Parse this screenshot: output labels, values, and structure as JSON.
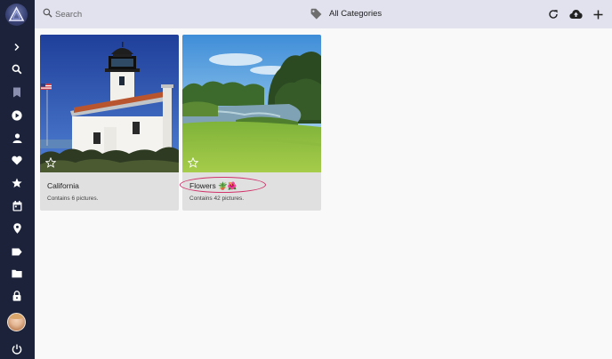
{
  "search": {
    "placeholder": "Search"
  },
  "header": {
    "category_label": "All Categories"
  },
  "sidebar": {
    "items": [
      {
        "icon": "chevron-right-icon"
      },
      {
        "icon": "search-icon"
      },
      {
        "icon": "bookmark-icon"
      },
      {
        "icon": "play-circle-icon"
      },
      {
        "icon": "person-icon"
      },
      {
        "icon": "heart-icon"
      },
      {
        "icon": "star-icon"
      },
      {
        "icon": "calendar-icon"
      },
      {
        "icon": "location-pin-icon"
      },
      {
        "icon": "label-icon"
      },
      {
        "icon": "folder-icon"
      },
      {
        "icon": "lock-icon"
      },
      {
        "icon": "power-icon"
      }
    ]
  },
  "albums": [
    {
      "title": "California",
      "subtitle": "Contains 6 pictures."
    },
    {
      "title": "Flowers 🪴🌺",
      "subtitle": "Contains 42 pictures."
    }
  ],
  "colors": {
    "sidebar": "#1b2239",
    "topbar": "#e1e2ee",
    "highlight": "#d2336b",
    "card": "#e0e0e0"
  }
}
